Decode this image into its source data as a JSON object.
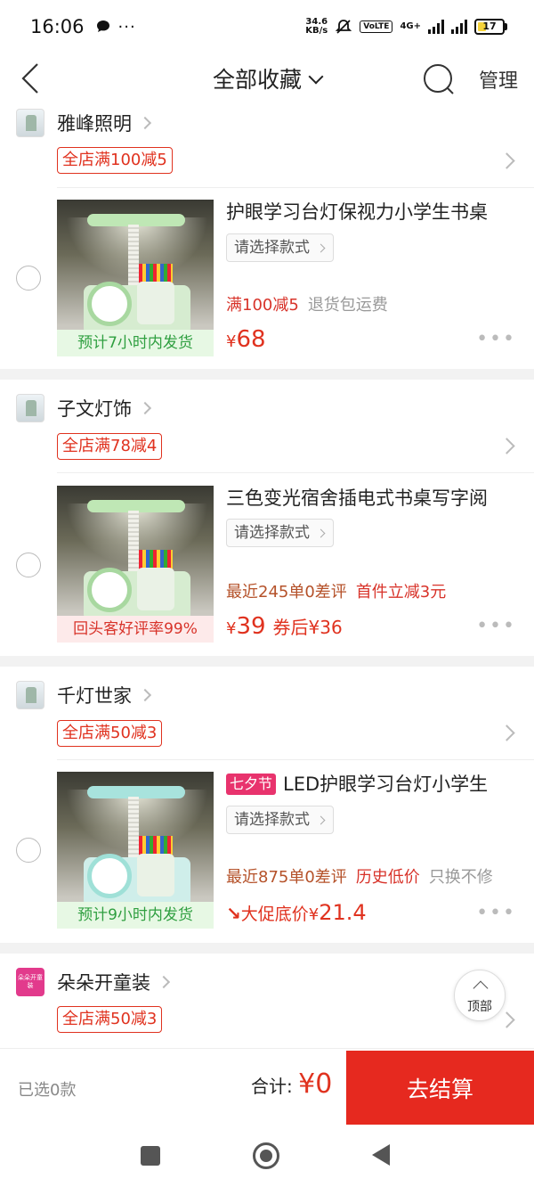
{
  "status_bar": {
    "time": "16:06",
    "net_speed_value": "34.6",
    "net_speed_unit": "KB/s",
    "volte": "VoLTE",
    "network": "4G+",
    "battery": "17"
  },
  "header": {
    "title": "全部收藏",
    "manage": "管理"
  },
  "stores": [
    {
      "name": "雅峰照明",
      "promo": "全店满100减5",
      "product": {
        "title": "护眼学习台灯保视力小学生书桌",
        "tag": "",
        "sku": "请选择款式",
        "thumb_tag": "预计7小时内发货",
        "meta": [
          "满100减5",
          "退货包运费"
        ],
        "price": "68",
        "price_after": ""
      }
    },
    {
      "name": "子文灯饰",
      "promo": "全店满78减4",
      "product": {
        "title": "三色变光宿舍插电式书桌写字阅",
        "tag": "",
        "sku": "请选择款式",
        "thumb_tag": "回头客好评率99%",
        "meta": [
          "最近245单0差评",
          "首件立减3元"
        ],
        "price": "39",
        "price_after": "券后¥36"
      }
    },
    {
      "name": "千灯世家",
      "promo": "全店满50减3",
      "product": {
        "title": "LED护眼学习台灯小学生",
        "tag": "七夕节",
        "sku": "请选择款式",
        "thumb_tag": "预计9小时内发货",
        "meta": [
          "最近875单0差评",
          "历史低价",
          "只换不修"
        ],
        "price_label": "大促底价",
        "price": "21.4"
      }
    },
    {
      "name": "朵朵开童装",
      "logo_text": "朵朵开童装",
      "promo": "全店满50减3"
    }
  ],
  "top_button": "顶部",
  "bottom": {
    "selected": "已选0款",
    "total_label": "合计:",
    "total_amount": "¥0",
    "checkout": "去结算"
  },
  "currency": "¥",
  "colors": {
    "accent": "#e6291f",
    "promo": "#e0321f",
    "green": "#2f9f40"
  }
}
